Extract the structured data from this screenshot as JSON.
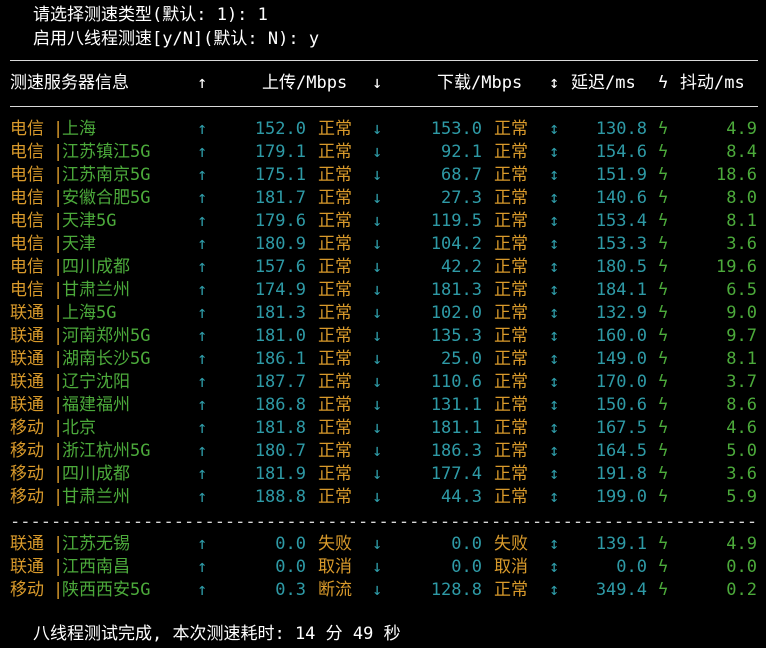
{
  "prompts": {
    "line1": "请选择测速类型(默认: 1): 1",
    "line2": "启用八线程测速[y/N](默认: N): y"
  },
  "header": {
    "server": "测速服务器信息",
    "up_arrow": "↑",
    "upload": "上传/Mbps",
    "down_arrow": "↓",
    "download": "下载/Mbps",
    "updown_arrow": "↕",
    "latency": "延迟/ms",
    "jitter_icon": "ϟ",
    "jitter": "抖动/ms"
  },
  "rows": [
    {
      "isp": "电信",
      "loc": "上海",
      "up": "152.0",
      "up_status": "正常",
      "down": "153.0",
      "down_status": "正常",
      "latency": "130.8",
      "jitter": "4.9"
    },
    {
      "isp": "电信",
      "loc": "江苏镇江5G",
      "up": "179.1",
      "up_status": "正常",
      "down": "92.1",
      "down_status": "正常",
      "latency": "154.6",
      "jitter": "8.4"
    },
    {
      "isp": "电信",
      "loc": "江苏南京5G",
      "up": "175.1",
      "up_status": "正常",
      "down": "68.7",
      "down_status": "正常",
      "latency": "151.9",
      "jitter": "18.6"
    },
    {
      "isp": "电信",
      "loc": "安徽合肥5G",
      "up": "181.7",
      "up_status": "正常",
      "down": "27.3",
      "down_status": "正常",
      "latency": "140.6",
      "jitter": "8.0"
    },
    {
      "isp": "电信",
      "loc": "天津5G",
      "up": "179.6",
      "up_status": "正常",
      "down": "119.5",
      "down_status": "正常",
      "latency": "153.4",
      "jitter": "8.1"
    },
    {
      "isp": "电信",
      "loc": "天津",
      "up": "180.9",
      "up_status": "正常",
      "down": "104.2",
      "down_status": "正常",
      "latency": "153.3",
      "jitter": "3.6"
    },
    {
      "isp": "电信",
      "loc": "四川成都",
      "up": "157.6",
      "up_status": "正常",
      "down": "42.2",
      "down_status": "正常",
      "latency": "180.5",
      "jitter": "19.6"
    },
    {
      "isp": "电信",
      "loc": "甘肃兰州",
      "up": "174.9",
      "up_status": "正常",
      "down": "181.3",
      "down_status": "正常",
      "latency": "184.1",
      "jitter": "6.5"
    },
    {
      "isp": "联通",
      "loc": "上海5G",
      "up": "181.3",
      "up_status": "正常",
      "down": "102.0",
      "down_status": "正常",
      "latency": "132.9",
      "jitter": "9.0"
    },
    {
      "isp": "联通",
      "loc": "河南郑州5G",
      "up": "181.0",
      "up_status": "正常",
      "down": "135.3",
      "down_status": "正常",
      "latency": "160.0",
      "jitter": "9.7"
    },
    {
      "isp": "联通",
      "loc": "湖南长沙5G",
      "up": "186.1",
      "up_status": "正常",
      "down": "25.0",
      "down_status": "正常",
      "latency": "149.0",
      "jitter": "8.1"
    },
    {
      "isp": "联通",
      "loc": "辽宁沈阳",
      "up": "187.7",
      "up_status": "正常",
      "down": "110.6",
      "down_status": "正常",
      "latency": "170.0",
      "jitter": "3.7"
    },
    {
      "isp": "联通",
      "loc": "福建福州",
      "up": "186.8",
      "up_status": "正常",
      "down": "131.1",
      "down_status": "正常",
      "latency": "150.6",
      "jitter": "8.6"
    },
    {
      "isp": "移动",
      "loc": "北京",
      "up": "181.8",
      "up_status": "正常",
      "down": "181.1",
      "down_status": "正常",
      "latency": "167.5",
      "jitter": "4.6"
    },
    {
      "isp": "移动",
      "loc": "浙江杭州5G",
      "up": "180.7",
      "up_status": "正常",
      "down": "186.3",
      "down_status": "正常",
      "latency": "164.5",
      "jitter": "5.0"
    },
    {
      "isp": "移动",
      "loc": "四川成都",
      "up": "181.9",
      "up_status": "正常",
      "down": "177.4",
      "down_status": "正常",
      "latency": "191.8",
      "jitter": "3.6"
    },
    {
      "isp": "移动",
      "loc": "甘肃兰州",
      "up": "188.8",
      "up_status": "正常",
      "down": "44.3",
      "down_status": "正常",
      "latency": "199.0",
      "jitter": "5.9"
    }
  ],
  "failed_rows": [
    {
      "isp": "联通",
      "loc": "江苏无锡",
      "up": "0.0",
      "up_status": "失败",
      "down": "0.0",
      "down_status": "失败",
      "latency": "139.1",
      "jitter": "4.9"
    },
    {
      "isp": "联通",
      "loc": "江西南昌",
      "up": "0.0",
      "up_status": "取消",
      "down": "0.0",
      "down_status": "取消",
      "latency": "0.0",
      "jitter": "0.0"
    },
    {
      "isp": "移动",
      "loc": "陕西西安5G",
      "up": "0.3",
      "up_status": "断流",
      "down": "128.8",
      "down_status": "正常",
      "latency": "349.4",
      "jitter": "0.2"
    }
  ],
  "row_symbols": {
    "pipe": "|",
    "up": "↑",
    "down": "↓",
    "updown": "↕",
    "jitter": "ϟ"
  },
  "footer": "八线程测试完成, 本次测速耗时: 14 分 49 秒",
  "colors": {
    "isp": "#d99a2b",
    "location": "#4caa3b",
    "cyan": "#2e9aa6",
    "status": "#d99a2b",
    "background": "#000000"
  }
}
